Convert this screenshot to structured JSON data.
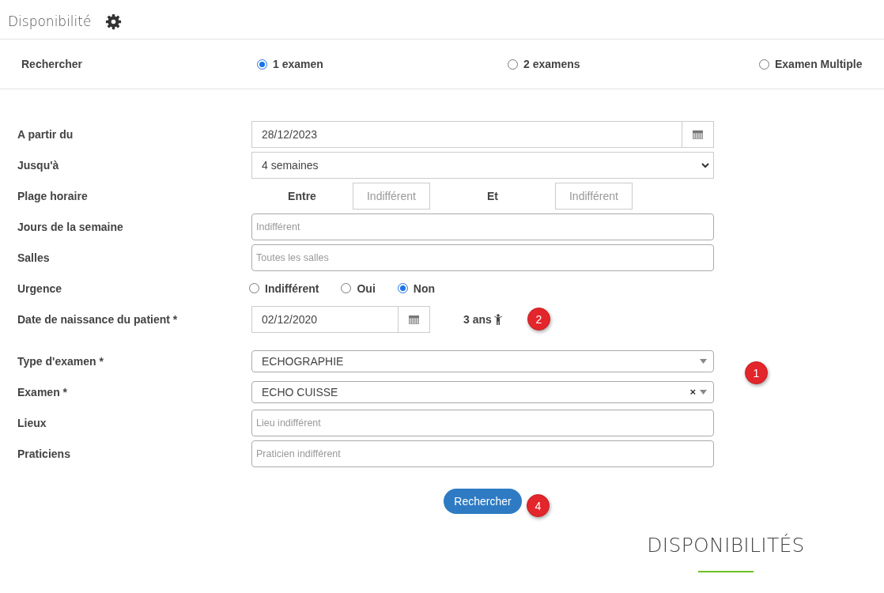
{
  "header": {
    "title": "Disponibilité"
  },
  "search_mode": {
    "label": "Rechercher",
    "options": [
      {
        "label": "1 examen",
        "selected": true
      },
      {
        "label": "2 examens",
        "selected": false
      },
      {
        "label": "Examen Multiple",
        "selected": false
      }
    ]
  },
  "form": {
    "rows": [
      {
        "kind": "date",
        "label": "A partir du",
        "value": "28/12/2023"
      },
      {
        "kind": "select",
        "label": "Jusqu'à",
        "value": "4 semaines"
      },
      {
        "kind": "time_range",
        "label": "Plage horaire",
        "from_label": "Entre",
        "from_placeholder": "Indifférent",
        "to_label": "Et",
        "to_placeholder": "Indifférent"
      },
      {
        "kind": "text",
        "label": "Jours de la semaine",
        "placeholder": "Indifférent"
      },
      {
        "kind": "text",
        "label": "Salles",
        "placeholder": "Toutes les salles"
      },
      {
        "kind": "radios",
        "label": "Urgence",
        "options": [
          {
            "label": "Indifférent",
            "selected": false
          },
          {
            "label": "Oui",
            "selected": false
          },
          {
            "label": "Non",
            "selected": true
          }
        ]
      },
      {
        "kind": "birthdate",
        "label": "Date de naissance du patient *",
        "value": "02/12/2020",
        "age": "3 ans",
        "badge": "2"
      },
      {
        "kind": "combo",
        "label": "Type d'examen *",
        "value": "ECHOGRAPHIE",
        "badge": "1"
      },
      {
        "kind": "combo",
        "label": "Examen *",
        "value": "ECHO CUISSE",
        "clear": "×"
      },
      {
        "kind": "text",
        "label": "Lieux",
        "placeholder": "Lieu indifférent"
      },
      {
        "kind": "text",
        "label": "Praticiens",
        "placeholder": "Praticien indifférent"
      }
    ]
  },
  "search_button": {
    "label": "Rechercher",
    "badge": "4"
  },
  "results": {
    "title": "DISPONIBILITÉS"
  }
}
